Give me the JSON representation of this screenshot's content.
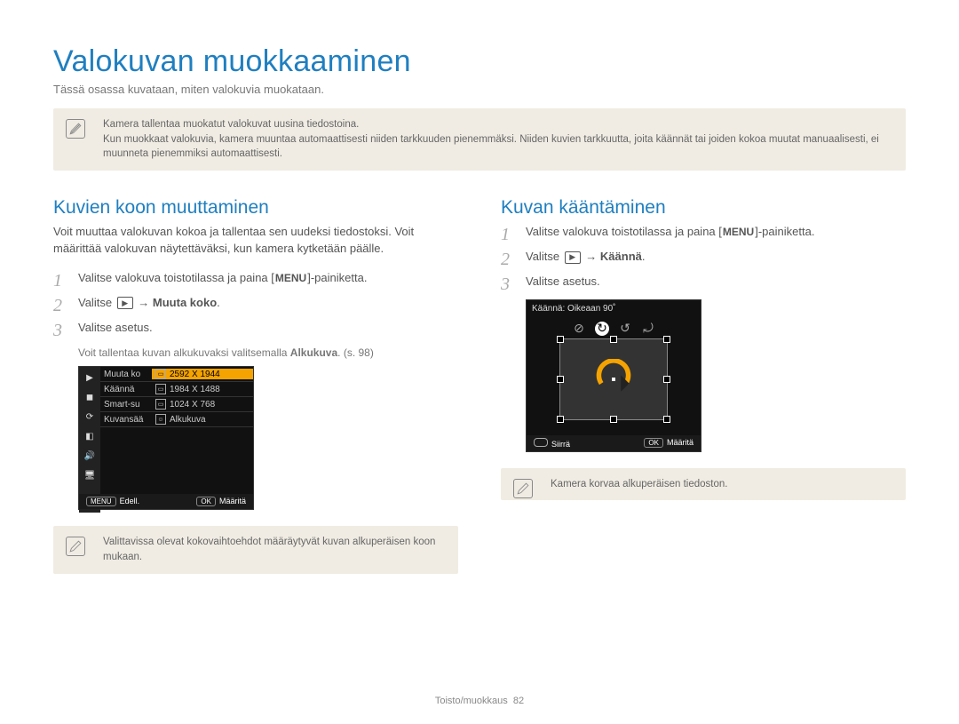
{
  "title": "Valokuvan muokkaaminen",
  "subtitle": "Tässä osassa kuvataan, miten valokuvia muokataan.",
  "top_note": {
    "line1": "Kamera tallentaa muokatut valokuvat uusina tiedostoina.",
    "line2": "Kun muokkaat valokuvia, kamera muuntaa automaattisesti niiden tarkkuuden pienemmäksi. Niiden kuvien tarkkuutta, joita käännät tai joiden kokoa muutat manuaalisesti, ei muunneta pienemmiksi automaattisesti."
  },
  "left": {
    "heading": "Kuvien koon muuttaminen",
    "intro": "Voit muuttaa valokuvan kokoa ja tallentaa sen uudeksi tiedostoksi. Voit määrittää valokuvan näytettäväksi, kun kamera kytketään päälle.",
    "step1_pre": "Valitse valokuva toistotilassa ja paina [",
    "menu_label": "MENU",
    "step1_post": "]-painiketta.",
    "step2_pre": "Valitse ",
    "edit_glyph": "▶",
    "step2_arrow": " → ",
    "step2_bold": "Muuta koko",
    "step2_end": ".",
    "step3": "Valitse asetus.",
    "footnote_pre": "Voit tallentaa kuvan alkukuvaksi valitsemalla ",
    "footnote_bold": "Alkukuva",
    "footnote_post": ". (s. 98)",
    "lcd": {
      "left_icons": [
        "▶",
        "◼",
        "⟳",
        "◧",
        "🔊",
        "🖥"
      ],
      "rows": [
        {
          "a": "Muuta ko",
          "b": "2592 X 1944",
          "selected": true
        },
        {
          "a": "Käännä",
          "b": "1984 X 1488",
          "selected": false
        },
        {
          "a": "Smart-su",
          "b": "1024 X 768",
          "selected": false
        },
        {
          "a": "Kuvansää",
          "b": "Alkukuva",
          "selected": false
        }
      ],
      "back": "Edell.",
      "ok": "OK",
      "set": "Määritä",
      "menu": "MENU"
    },
    "bottom_note": "Valittavissa olevat kokovaihtoehdot määräytyvät kuvan alkuperäisen koon mukaan."
  },
  "right": {
    "heading": "Kuvan kääntäminen",
    "step1_pre": "Valitse valokuva toistotilassa ja paina [",
    "menu_label": "MENU",
    "step1_post": "]-painiketta.",
    "step2_pre": "Valitse ",
    "edit_glyph": "▶",
    "step2_arrow": " → ",
    "step2_bold": "Käännä",
    "step2_end": ".",
    "step3": "Valitse asetus.",
    "lcd": {
      "title": "Käännä: Oikeaan 90˚",
      "move": "Siirrä",
      "ok": "OK",
      "set": "Määritä"
    },
    "bottom_note": "Kamera korvaa alkuperäisen tiedoston."
  },
  "footer": {
    "section": "Toisto/muokkaus",
    "page": "82"
  }
}
